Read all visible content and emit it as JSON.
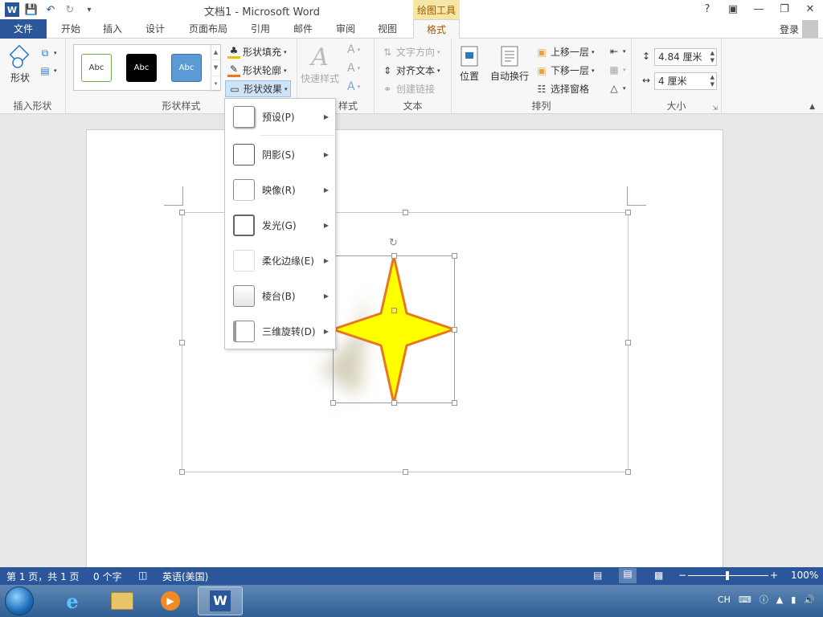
{
  "titlebar": {
    "title": "文档1 - Microsoft Word",
    "contextual_tab": "绘图工具",
    "help": "?",
    "qat_more": "▾"
  },
  "tabs": [
    {
      "label": "文件"
    },
    {
      "label": "开始"
    },
    {
      "label": "插入"
    },
    {
      "label": "设计"
    },
    {
      "label": "页面布局"
    },
    {
      "label": "引用"
    },
    {
      "label": "邮件"
    },
    {
      "label": "审阅"
    },
    {
      "label": "视图"
    },
    {
      "label": "格式"
    }
  ],
  "signin": "登录",
  "ribbon": {
    "insert_shapes": {
      "shapes_label": "形状",
      "group_label": "插入形状"
    },
    "shape_styles": {
      "swatch_text": "Abc",
      "fill": "形状填充",
      "outline": "形状轮廓",
      "effects": "形状效果",
      "group_label": "形状样式"
    },
    "wordart": {
      "quick_styles": "快速样式",
      "group_label_partial": "样式"
    },
    "text": {
      "direction": "文字方向",
      "align": "对齐文本",
      "link": "创建链接",
      "group_label": "文本"
    },
    "arrange": {
      "position": "位置",
      "wrap": "自动换行",
      "forward": "上移一层",
      "backward": "下移一层",
      "pane": "选择窗格",
      "group_label": "排列"
    },
    "size": {
      "height": "4.84 厘米",
      "width": "4 厘米",
      "group_label": "大小"
    }
  },
  "effects_menu": [
    {
      "label": "预设(P)"
    },
    {
      "label": "阴影(S)"
    },
    {
      "label": "映像(R)"
    },
    {
      "label": "发光(G)"
    },
    {
      "label": "柔化边缘(E)"
    },
    {
      "label": "棱台(B)"
    },
    {
      "label": "三维旋转(D)"
    }
  ],
  "statusbar": {
    "page": "第 1 页，共 1 页",
    "words": "0 个字",
    "language": "英语(美国)",
    "zoom": "100%"
  },
  "tray": {
    "lang": "CH"
  },
  "colors": {
    "accent": "#2b579a",
    "contextual": "#a05a00",
    "star_fill": "#ffff00",
    "star_stroke": "#e87722"
  }
}
